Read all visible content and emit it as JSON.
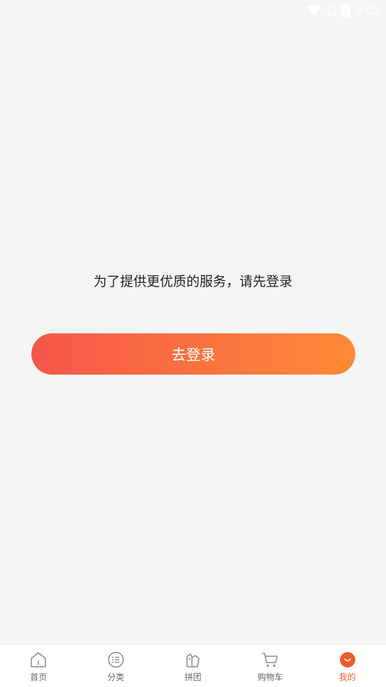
{
  "status_bar": {
    "time": "3:05"
  },
  "main": {
    "prompt": "为了提供更优质的服务，请先登录",
    "login_button": "去登录"
  },
  "tabs": [
    {
      "label": "首页",
      "icon": "home-icon",
      "active": false
    },
    {
      "label": "分类",
      "icon": "category-icon",
      "active": false
    },
    {
      "label": "拼团",
      "icon": "group-buy-icon",
      "active": false
    },
    {
      "label": "购物车",
      "icon": "cart-icon",
      "active": false
    },
    {
      "label": "我的",
      "icon": "profile-icon",
      "active": true
    }
  ],
  "colors": {
    "accent": "#f05a28",
    "button_gradient_start": "#f5574a",
    "button_gradient_end": "#ff8a36",
    "background": "#f5f5f5",
    "inactive_tab": "#666666"
  }
}
